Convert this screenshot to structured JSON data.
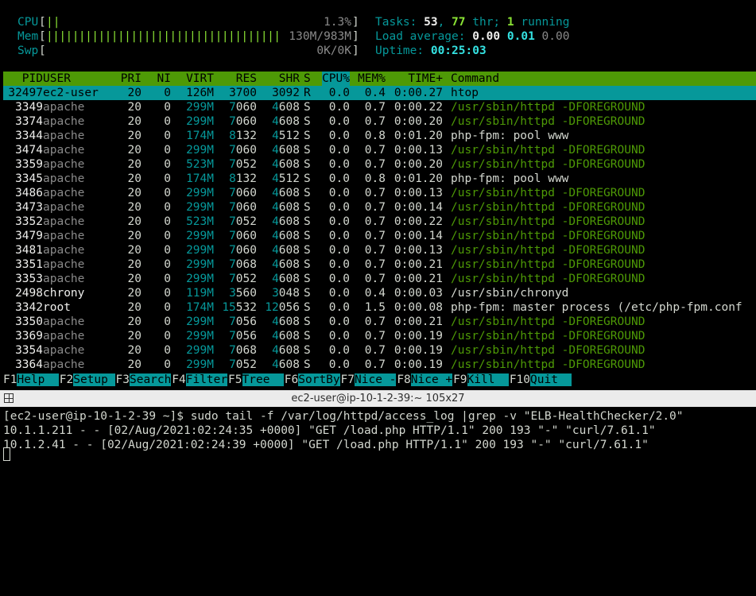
{
  "meters": {
    "cpu": {
      "label": "CPU",
      "bars": "||",
      "value": "1.3%"
    },
    "mem": {
      "label": "Mem",
      "bars": "||||||||||||||||||||||||||||||||||||",
      "value": "130M/983M"
    },
    "swp": {
      "label": "Swp",
      "bars": "",
      "value": "0K/0K"
    }
  },
  "stats": {
    "tasks_label": "Tasks: ",
    "tasks": "53",
    "sep1": ", ",
    "threads": "77",
    "thr_label": " thr; ",
    "running": "1",
    "running_label": " running",
    "load_label": "Load average: ",
    "load1": "0.00",
    "load5": "0.01",
    "load15": "0.00",
    "uptime_label": "Uptime: ",
    "uptime": "00:25:03"
  },
  "columns": [
    "PID",
    "USER",
    "PRI",
    "NI",
    "VIRT",
    "RES",
    "SHR",
    "S",
    "CPU%",
    "MEM%",
    "TIME+",
    "Command"
  ],
  "processes": [
    {
      "pid": "32497",
      "user": "ec2-user",
      "pri": "20",
      "ni": "0",
      "virt": "126M",
      "res": "3700",
      "shr": "3092",
      "s": "R",
      "cpu": "0.0",
      "mem": "0.4",
      "time": "0:00.27",
      "cmd": "htop"
    },
    {
      "pid": "3349",
      "user": "apache",
      "pri": "20",
      "ni": "0",
      "virt": "299M",
      "res": "7060",
      "shr": "4608",
      "s": "S",
      "cpu": "0.0",
      "mem": "0.7",
      "time": "0:00.22",
      "cmd": "/usr/sbin/httpd -DFOREGROUND"
    },
    {
      "pid": "3374",
      "user": "apache",
      "pri": "20",
      "ni": "0",
      "virt": "299M",
      "res": "7060",
      "shr": "4608",
      "s": "S",
      "cpu": "0.0",
      "mem": "0.7",
      "time": "0:00.20",
      "cmd": "/usr/sbin/httpd -DFOREGROUND"
    },
    {
      "pid": "3344",
      "user": "apache",
      "pri": "20",
      "ni": "0",
      "virt": "174M",
      "res": "8132",
      "shr": "4512",
      "s": "S",
      "cpu": "0.0",
      "mem": "0.8",
      "time": "0:01.20",
      "cmd": "php-fpm: pool www"
    },
    {
      "pid": "3474",
      "user": "apache",
      "pri": "20",
      "ni": "0",
      "virt": "299M",
      "res": "7060",
      "shr": "4608",
      "s": "S",
      "cpu": "0.0",
      "mem": "0.7",
      "time": "0:00.13",
      "cmd": "/usr/sbin/httpd -DFOREGROUND"
    },
    {
      "pid": "3359",
      "user": "apache",
      "pri": "20",
      "ni": "0",
      "virt": "523M",
      "res": "7052",
      "shr": "4608",
      "s": "S",
      "cpu": "0.0",
      "mem": "0.7",
      "time": "0:00.20",
      "cmd": "/usr/sbin/httpd -DFOREGROUND"
    },
    {
      "pid": "3345",
      "user": "apache",
      "pri": "20",
      "ni": "0",
      "virt": "174M",
      "res": "8132",
      "shr": "4512",
      "s": "S",
      "cpu": "0.0",
      "mem": "0.8",
      "time": "0:01.20",
      "cmd": "php-fpm: pool www"
    },
    {
      "pid": "3486",
      "user": "apache",
      "pri": "20",
      "ni": "0",
      "virt": "299M",
      "res": "7060",
      "shr": "4608",
      "s": "S",
      "cpu": "0.0",
      "mem": "0.7",
      "time": "0:00.13",
      "cmd": "/usr/sbin/httpd -DFOREGROUND"
    },
    {
      "pid": "3473",
      "user": "apache",
      "pri": "20",
      "ni": "0",
      "virt": "299M",
      "res": "7060",
      "shr": "4608",
      "s": "S",
      "cpu": "0.0",
      "mem": "0.7",
      "time": "0:00.14",
      "cmd": "/usr/sbin/httpd -DFOREGROUND"
    },
    {
      "pid": "3352",
      "user": "apache",
      "pri": "20",
      "ni": "0",
      "virt": "523M",
      "res": "7052",
      "shr": "4608",
      "s": "S",
      "cpu": "0.0",
      "mem": "0.7",
      "time": "0:00.22",
      "cmd": "/usr/sbin/httpd -DFOREGROUND"
    },
    {
      "pid": "3479",
      "user": "apache",
      "pri": "20",
      "ni": "0",
      "virt": "299M",
      "res": "7060",
      "shr": "4608",
      "s": "S",
      "cpu": "0.0",
      "mem": "0.7",
      "time": "0:00.14",
      "cmd": "/usr/sbin/httpd -DFOREGROUND"
    },
    {
      "pid": "3481",
      "user": "apache",
      "pri": "20",
      "ni": "0",
      "virt": "299M",
      "res": "7060",
      "shr": "4608",
      "s": "S",
      "cpu": "0.0",
      "mem": "0.7",
      "time": "0:00.13",
      "cmd": "/usr/sbin/httpd -DFOREGROUND"
    },
    {
      "pid": "3351",
      "user": "apache",
      "pri": "20",
      "ni": "0",
      "virt": "299M",
      "res": "7068",
      "shr": "4608",
      "s": "S",
      "cpu": "0.0",
      "mem": "0.7",
      "time": "0:00.21",
      "cmd": "/usr/sbin/httpd -DFOREGROUND"
    },
    {
      "pid": "3353",
      "user": "apache",
      "pri": "20",
      "ni": "0",
      "virt": "299M",
      "res": "7052",
      "shr": "4608",
      "s": "S",
      "cpu": "0.0",
      "mem": "0.7",
      "time": "0:00.21",
      "cmd": "/usr/sbin/httpd -DFOREGROUND"
    },
    {
      "pid": "2498",
      "user": "chrony",
      "pri": "20",
      "ni": "0",
      "virt": "119M",
      "res": "3560",
      "shr": "3048",
      "s": "S",
      "cpu": "0.0",
      "mem": "0.4",
      "time": "0:00.03",
      "cmd": "/usr/sbin/chronyd"
    },
    {
      "pid": "3342",
      "user": "root",
      "pri": "20",
      "ni": "0",
      "virt": "174M",
      "res": "15532",
      "shr": "12056",
      "s": "S",
      "cpu": "0.0",
      "mem": "1.5",
      "time": "0:00.08",
      "cmd": "php-fpm: master process (/etc/php-fpm.conf"
    },
    {
      "pid": "3350",
      "user": "apache",
      "pri": "20",
      "ni": "0",
      "virt": "299M",
      "res": "7056",
      "shr": "4608",
      "s": "S",
      "cpu": "0.0",
      "mem": "0.7",
      "time": "0:00.21",
      "cmd": "/usr/sbin/httpd -DFOREGROUND"
    },
    {
      "pid": "3369",
      "user": "apache",
      "pri": "20",
      "ni": "0",
      "virt": "299M",
      "res": "7056",
      "shr": "4608",
      "s": "S",
      "cpu": "0.0",
      "mem": "0.7",
      "time": "0:00.19",
      "cmd": "/usr/sbin/httpd -DFOREGROUND"
    },
    {
      "pid": "3354",
      "user": "apache",
      "pri": "20",
      "ni": "0",
      "virt": "299M",
      "res": "7068",
      "shr": "4608",
      "s": "S",
      "cpu": "0.0",
      "mem": "0.7",
      "time": "0:00.19",
      "cmd": "/usr/sbin/httpd -DFOREGROUND"
    },
    {
      "pid": "3364",
      "user": "apache",
      "pri": "20",
      "ni": "0",
      "virt": "299M",
      "res": "7052",
      "shr": "4608",
      "s": "S",
      "cpu": "0.0",
      "mem": "0.7",
      "time": "0:00.19",
      "cmd": "/usr/sbin/httpd -DFOREGROUND"
    }
  ],
  "fkeys": [
    {
      "key": "F1",
      "label": "Help  "
    },
    {
      "key": "F2",
      "label": "Setup "
    },
    {
      "key": "F3",
      "label": "Search"
    },
    {
      "key": "F4",
      "label": "Filter"
    },
    {
      "key": "F5",
      "label": "Tree  "
    },
    {
      "key": "F6",
      "label": "SortBy"
    },
    {
      "key": "F7",
      "label": "Nice -"
    },
    {
      "key": "F8",
      "label": "Nice +"
    },
    {
      "key": "F9",
      "label": "Kill  "
    },
    {
      "key": "F10",
      "label": "Quit  "
    }
  ],
  "terminal": {
    "title": "ec2-user@ip-10-1-2-39:~ 105x27",
    "lines": [
      "[ec2-user@ip-10-1-2-39 ~]$ sudo tail -f /var/log/httpd/access_log |grep -v \"ELB-HealthChecker/2.0\"",
      "10.1.1.211 - - [02/Aug/2021:02:24:35 +0000] \"GET /load.php HTTP/1.1\" 200 193 \"-\" \"curl/7.61.1\"",
      "10.1.2.41 - - [02/Aug/2021:02:24:39 +0000] \"GET /load.php HTTP/1.1\" 200 193 \"-\" \"curl/7.61.1\""
    ]
  },
  "colors": {
    "header_bg": "#4e9a06",
    "selected_bg": "#06989a",
    "label_cyan": "#06989a",
    "httpd_green": "#4e9a06"
  }
}
